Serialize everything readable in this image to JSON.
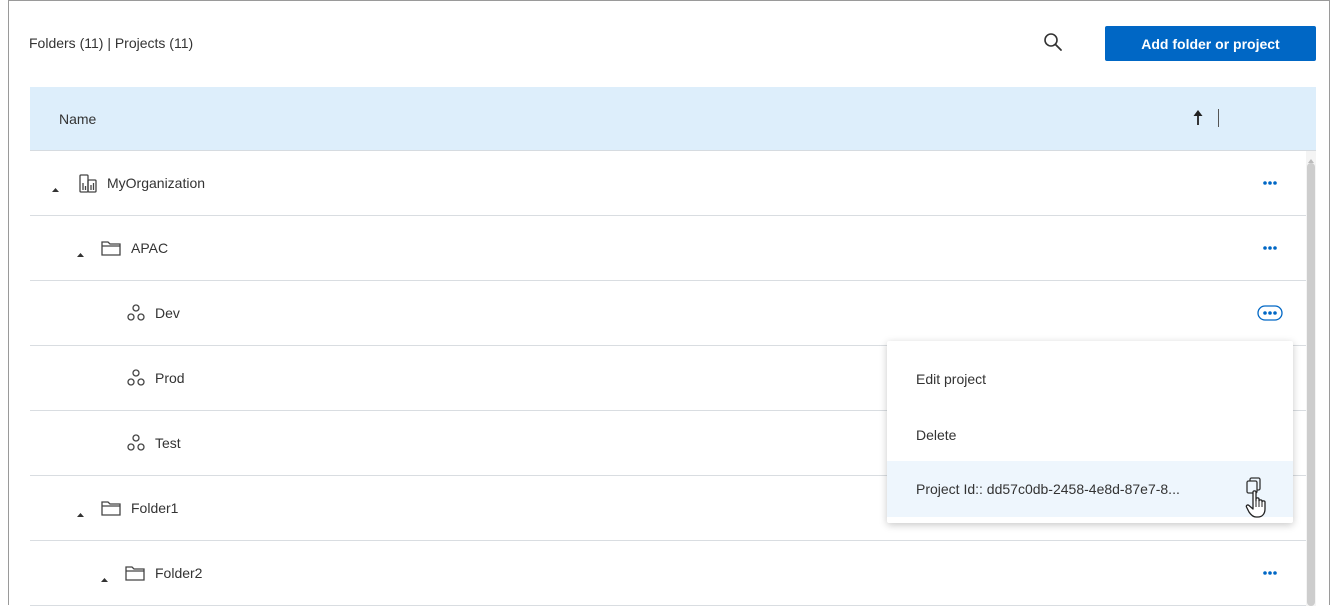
{
  "header": {
    "title": "Folders (11) | Projects (11)",
    "add_label": "Add folder or project",
    "search_icon": "search-icon"
  },
  "table": {
    "col_name": "Name",
    "sort": "ascending"
  },
  "rows": [
    {
      "label": "MyOrganization",
      "type": "organization",
      "expanded": true
    },
    {
      "label": "APAC",
      "type": "folder",
      "expanded": true
    },
    {
      "label": "Dev",
      "type": "project"
    },
    {
      "label": "Prod",
      "type": "project"
    },
    {
      "label": "Test",
      "type": "project"
    },
    {
      "label": "Folder1",
      "type": "folder",
      "expanded": true
    },
    {
      "label": "Folder2",
      "type": "folder",
      "expanded": true
    }
  ],
  "menu": {
    "edit": "Edit project",
    "delete": "Delete",
    "project_id": "Project Id:: dd57c0db-2458-4e8d-87e7-8..."
  },
  "colors": {
    "accent": "#0067c5",
    "header_bg": "#ddeefb",
    "menu_hover": "#eef6fd"
  }
}
